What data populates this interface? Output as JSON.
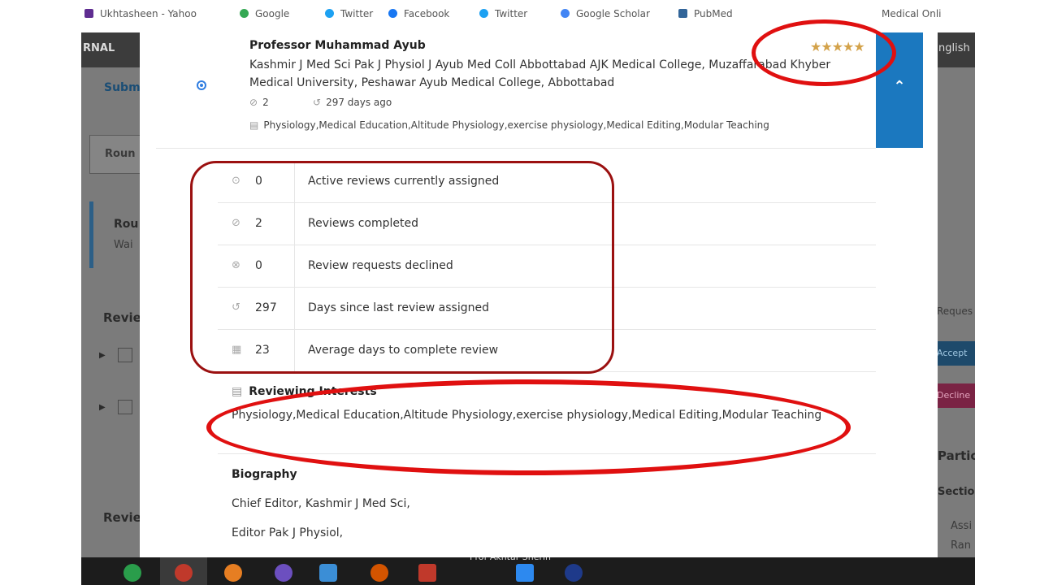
{
  "bookmarks": [
    {
      "label": "Ukhtasheen - Yahoo",
      "color": "#5f2d91"
    },
    {
      "label": "Google",
      "color": "#34a853"
    },
    {
      "label": "Twitter",
      "color": "#1da1f2"
    },
    {
      "label": "Facebook",
      "color": "#1877f2"
    },
    {
      "label": "Twitter",
      "color": "#1da1f2"
    },
    {
      "label": "Google Scholar",
      "color": "#4285f4"
    },
    {
      "label": "PubMed",
      "color": "#326599"
    },
    {
      "label": "Medical Onli",
      "color": "#888888"
    }
  ],
  "background_page": {
    "brand": "RNAL",
    "language": "nglish",
    "submission_tab": "Subm",
    "round_tab": "Roun",
    "round_title": "Rou",
    "round_status": "Wai",
    "reviewers_head": "Revie",
    "reviewers_head_2": "Revie",
    "request_label": "Reques",
    "accept_button": "Accept",
    "decline_button": "Decline",
    "participants_head": "Partic",
    "section_head": "Sectio",
    "assign_text": "Assi",
    "ran_text": "Ran"
  },
  "reviewer": {
    "name": "Professor Muhammad Ayub",
    "affiliation": "Kashmir J Med Sci Pak J Physiol J Ayub Med Coll Abbottabad AJK Medical College, Muzaffarabad Khyber Medical University, Peshawar Ayub Medical College, Abbottabad",
    "stars": "★★★★★",
    "rating": 5,
    "completed_count": "2",
    "last_assigned": "297 days ago",
    "interests_short": "Physiology,Medical Education,Altitude Physiology,exercise physiology,Medical Editing,Modular Teaching",
    "collapse_icon": "chevron-up-icon"
  },
  "stats": [
    {
      "icon": "clock-icon",
      "glyph": "⊙",
      "value": "0",
      "label": "Active reviews currently assigned"
    },
    {
      "icon": "check-circle-icon",
      "glyph": "⊘",
      "value": "2",
      "label": "Reviews completed"
    },
    {
      "icon": "declined-circle-icon",
      "glyph": "⊗",
      "value": "0",
      "label": "Review requests declined"
    },
    {
      "icon": "history-icon",
      "glyph": "↺",
      "value": "297",
      "label": "Days since last review assigned"
    },
    {
      "icon": "calendar-icon",
      "glyph": "▦",
      "value": "23",
      "label": "Average days to complete review"
    }
  ],
  "reviewing_interests": {
    "heading": "Reviewing Interests",
    "text": "Physiology,Medical Education,Altitude Physiology,exercise physiology,Medical Editing,Modular Teaching"
  },
  "biography": {
    "heading": "Biography",
    "lines": [
      "Chief Editor, Kashmir J Med Sci,",
      "Editor Pak J Physiol,"
    ]
  },
  "watermark": "Prof Akhtar Sherin",
  "colors": {
    "accent": "#1b78bf",
    "stars": "#d3a24a",
    "annotation": "#e01010",
    "annotation_box": "#9b1010"
  }
}
